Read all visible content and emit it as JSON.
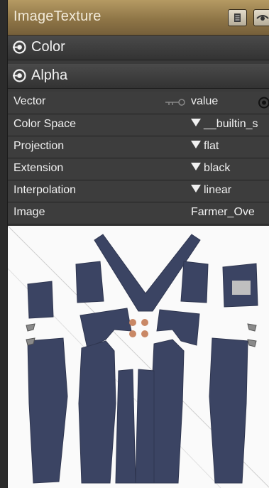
{
  "node": {
    "title": "ImageTexture",
    "header_buttons": [
      "list-icon",
      "eye-icon"
    ],
    "sockets": [
      {
        "label": "Color"
      },
      {
        "label": "Alpha"
      }
    ],
    "properties": {
      "vector": {
        "name": "Vector",
        "value": "value",
        "icon": "key-link-icon"
      },
      "color_space": {
        "name": "Color Space",
        "value": "__builtin_s"
      },
      "projection": {
        "name": "Projection",
        "value": "flat"
      },
      "extension": {
        "name": "Extension",
        "value": "black"
      },
      "interpolation": {
        "name": "Interpolation",
        "value": "linear"
      },
      "image": {
        "name": "Image",
        "value": "Farmer_Ove"
      }
    },
    "preview": {
      "description_icon": "uv-texture-preview",
      "fabric_color": "#3b4463",
      "button_color": "#c98866"
    }
  },
  "colors": {
    "header": "#8f7647",
    "panel": "#3a3a3a",
    "text": "#f0f0f0"
  }
}
